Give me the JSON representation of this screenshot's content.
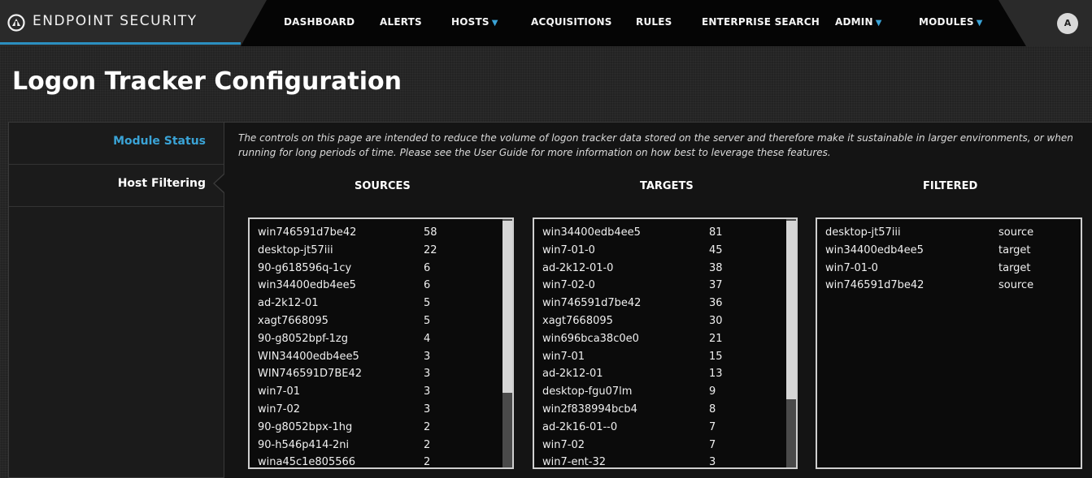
{
  "brand": {
    "name": "ENDPOINT SECURITY",
    "logo_icon": "endpoint-logo-icon"
  },
  "nav": [
    {
      "label": "DASHBOARD",
      "dropdown": false
    },
    {
      "label": "ALERTS",
      "dropdown": false
    },
    {
      "label": "HOSTS",
      "dropdown": true
    },
    {
      "label": "ACQUISITIONS",
      "dropdown": false
    },
    {
      "label": "RULES",
      "dropdown": false
    },
    {
      "label": "ENTERPRISE SEARCH",
      "dropdown": false
    },
    {
      "label": "ADMIN",
      "dropdown": true
    },
    {
      "label": "MODULES",
      "dropdown": true
    }
  ],
  "user": {
    "avatar_initial": "A"
  },
  "page": {
    "title": "Logon Tracker Configuration"
  },
  "sidebar": {
    "items": [
      {
        "label": "Module Status",
        "active": false
      },
      {
        "label": "Host Filtering",
        "active": true
      }
    ]
  },
  "intro": "The controls on this page are intended to reduce the volume of logon tracker data stored on the server and therefore make it sustainable in larger environments, or when running for long periods of time. Please see the User Guide for more information on how best to leverage these features.",
  "sources": {
    "header": "SOURCES",
    "rows": [
      {
        "name": "win746591d7be42",
        "count": "58"
      },
      {
        "name": "desktop-jt57iii",
        "count": "22"
      },
      {
        "name": "90-g618596q-1cy",
        "count": "6"
      },
      {
        "name": "win34400edb4ee5",
        "count": "6"
      },
      {
        "name": "ad-2k12-01",
        "count": "5"
      },
      {
        "name": "xagt7668095",
        "count": "5"
      },
      {
        "name": "90-g8052bpf-1zg",
        "count": "4"
      },
      {
        "name": "WIN34400edb4ee5",
        "count": "3"
      },
      {
        "name": "WIN746591D7BE42",
        "count": "3"
      },
      {
        "name": "win7-01",
        "count": "3"
      },
      {
        "name": "win7-02",
        "count": "3"
      },
      {
        "name": "90-g8052bpx-1hg",
        "count": "2"
      },
      {
        "name": "90-h546p414-2ni",
        "count": "2"
      },
      {
        "name": "wina45c1e805566",
        "count": "2"
      }
    ]
  },
  "targets": {
    "header": "TARGETS",
    "rows": [
      {
        "name": "win34400edb4ee5",
        "count": "81"
      },
      {
        "name": "win7-01-0",
        "count": "45"
      },
      {
        "name": "ad-2k12-01-0",
        "count": "38"
      },
      {
        "name": "win7-02-0",
        "count": "37"
      },
      {
        "name": "win746591d7be42",
        "count": "36"
      },
      {
        "name": "xagt7668095",
        "count": "30"
      },
      {
        "name": "win696bca38c0e0",
        "count": "21"
      },
      {
        "name": "win7-01",
        "count": "15"
      },
      {
        "name": "ad-2k12-01",
        "count": "13"
      },
      {
        "name": "desktop-fgu07lm",
        "count": "9"
      },
      {
        "name": "win2f838994bcb4",
        "count": "8"
      },
      {
        "name": "ad-2k16-01--0",
        "count": "7"
      },
      {
        "name": "win7-02",
        "count": "7"
      },
      {
        "name": "win7-ent-32",
        "count": "3"
      }
    ]
  },
  "filtered": {
    "header": "FILTERED",
    "rows": [
      {
        "name": "desktop-jt57iii",
        "type": "source"
      },
      {
        "name": "win34400edb4ee5",
        "type": "target"
      },
      {
        "name": "win7-01-0",
        "type": "target"
      },
      {
        "name": "win746591d7be42",
        "type": "source"
      }
    ]
  },
  "colors": {
    "accent": "#3aa3d6",
    "background": "#1c1c1c",
    "nav": "#050505"
  }
}
